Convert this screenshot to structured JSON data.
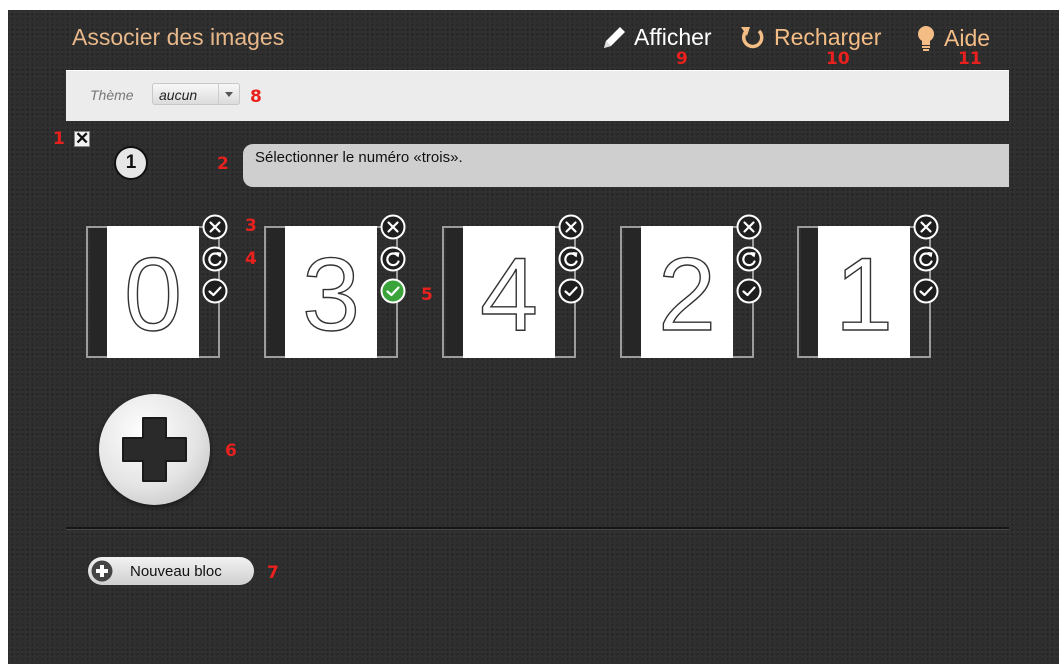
{
  "header": {
    "title": "Associer des images",
    "nav": [
      {
        "label": "Afficher",
        "icon": "pencil-icon"
      },
      {
        "label": "Recharger",
        "icon": "reload-icon"
      },
      {
        "label": "Aide",
        "icon": "lightbulb-icon"
      }
    ]
  },
  "toolbar": {
    "theme_label": "Thème",
    "theme_value": "aucun"
  },
  "block": {
    "close_glyph": "✕",
    "number": "1",
    "question": "Sélectionner le numéro «trois»."
  },
  "cards": [
    {
      "digit": "0",
      "correct": false
    },
    {
      "digit": "3",
      "correct": true
    },
    {
      "digit": "4",
      "correct": false
    },
    {
      "digit": "2",
      "correct": false
    },
    {
      "digit": "1",
      "correct": false
    }
  ],
  "footer": {
    "new_block_label": "Nouveau bloc"
  },
  "markers": [
    "1",
    "2",
    "3",
    "4",
    "5",
    "6",
    "7",
    "8",
    "9",
    "10",
    "11"
  ],
  "colors": {
    "title": "#e8b88a",
    "accent_green": "#3aa43a",
    "marker_red": "#e8211e",
    "background": "#2e2e2e"
  }
}
